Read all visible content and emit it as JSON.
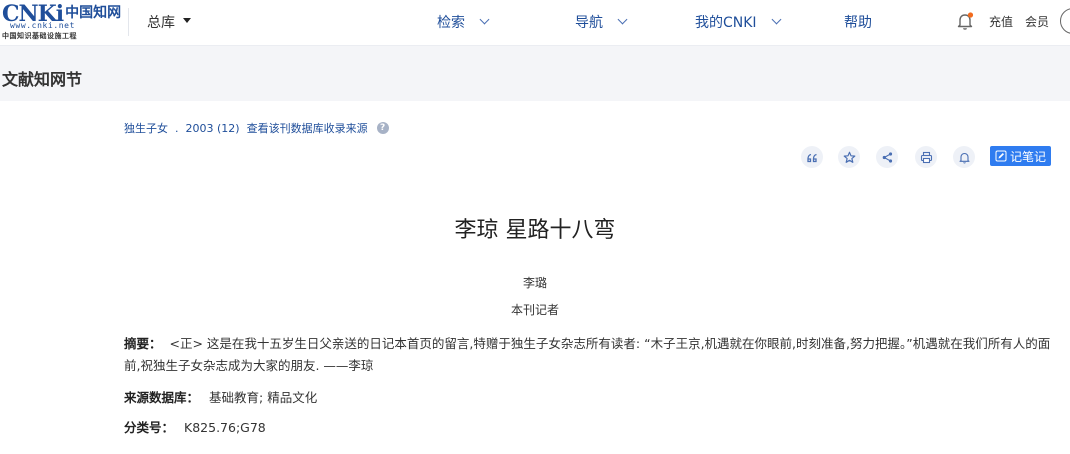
{
  "header": {
    "logo_brand": "CNKi",
    "logo_cn": "中国知网",
    "logo_url": "www.cnki.net",
    "logo_sub": "中国知识基础设施工程",
    "database_selector": "总库",
    "nav": [
      {
        "label": "检索"
      },
      {
        "label": "导航"
      },
      {
        "label": "我的CNKI"
      }
    ],
    "help": "帮助",
    "recharge": "充值",
    "member": "会员",
    "notification_dot_color": "#f26b1d"
  },
  "section": {
    "title": "文献知网节"
  },
  "article": {
    "source": {
      "journal": "独生子女",
      "dot": ".",
      "issue": "2003 (12)",
      "db_link": "查看该刊数据库收录来源"
    },
    "toolbar": {
      "icons": [
        "quote-icon",
        "star-icon",
        "share-icon",
        "print-icon",
        "bell-icon"
      ],
      "note_label": "记笔记"
    },
    "title": "李琼 星路十八弯",
    "author": "李璐",
    "organization": "本刊记者",
    "abstract_label": "摘要：",
    "abstract_text": "<正> 这是在我十五岁生日父亲送的日记本首页的留言,特赠于独生子女杂志所有读者: “木子王京,机遇就在你眼前,时刻准备,努力把握。”机遇就在我们所有人的面前,祝独生子女杂志成为大家的朋友. ——李琼",
    "source_db_label": "来源数据库：",
    "source_db_value": "基础教育; 精品文化",
    "classification_label": "分类号：",
    "classification_value": "K825.76;G78"
  },
  "colors": {
    "brand_blue": "#1f4e9a",
    "accent_button": "#2f7cf0"
  }
}
